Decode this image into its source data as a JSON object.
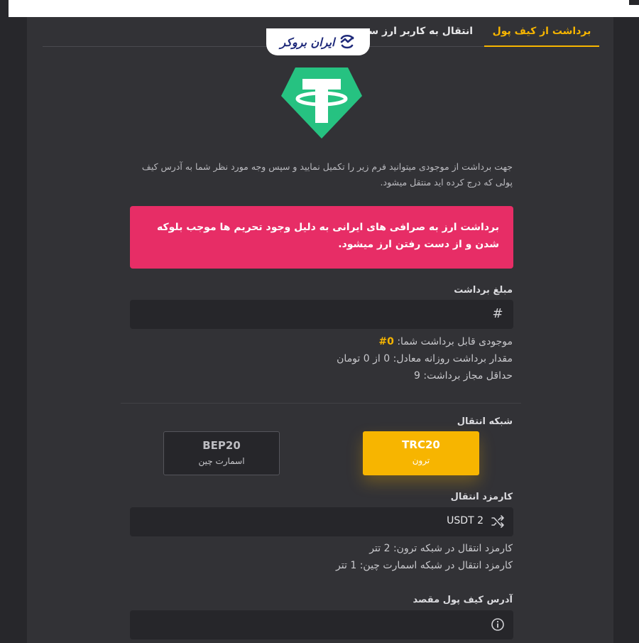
{
  "tabs": {
    "active_label": "برداشت از کیف پول",
    "second_label": "انتقال به کاربر ارز سه"
  },
  "brand": {
    "logo_text": "ایران بروکر"
  },
  "description": "جهت برداشت از موجودی میتوانید فرم زیر را تکمیل نمایید و سپس وجه مورد نظر شما به آدرس کیف پولی که درج کرده اید منتقل میشود.",
  "alert": {
    "text": "برداشت ارز به صرافی های ایرانی به دلیل وجود تحریم ها موجب بلوکه شدن و از دست رفتن ارز میشود."
  },
  "amount": {
    "label": "مبلغ برداشت",
    "value": "",
    "icon": "hash-icon"
  },
  "balance": {
    "prefix": "موجودی قابل برداشت شما:",
    "value": "0#",
    "daily": "مقدار برداشت روزانه معادل: 0 از 0 تومان",
    "minimum": "حداقل مجاز برداشت: 9"
  },
  "network": {
    "label": "شبکه انتقال",
    "options": [
      {
        "code": "TRC20",
        "name": "ترون",
        "selected": true
      },
      {
        "code": "BEP20",
        "name": "اسمارت چین",
        "selected": false
      }
    ]
  },
  "fee": {
    "label": "کارمزد انتقال",
    "value": "USDT 2",
    "icon": "shuffle-icon",
    "note_tron": "کارمزد انتقال در شبکه ترون: 2 تتر",
    "note_smart": "کارمزد انتقال در شبکه اسمارت چین: 1 تتر"
  },
  "address": {
    "label": "آدرس کیف پول مقصد",
    "value": "",
    "icon": "info-icon"
  },
  "colors": {
    "accent": "#f7b500",
    "alert": "#e72d66",
    "tether": "#26c281",
    "panel": "#323236",
    "background": "#27272b"
  }
}
